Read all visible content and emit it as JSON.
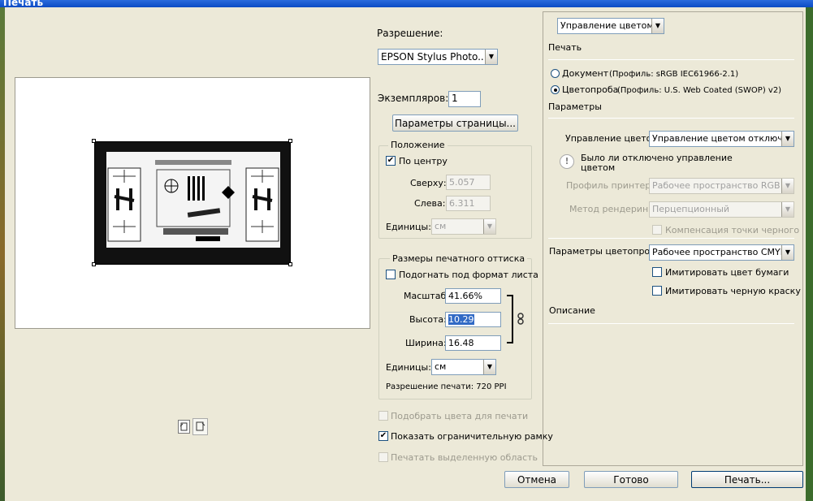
{
  "window": {
    "title": "Печать"
  },
  "left": {
    "resolution_label": "Разрешение:",
    "printer_value": "EPSON Stylus Photo...",
    "copies_label": "Экземпляров:",
    "copies_value": "1",
    "page_setup_button": "Параметры страницы...",
    "position": {
      "title": "Положение",
      "center_label": "По центру",
      "center_checked": true,
      "top_label": "Сверху:",
      "top_value": "5.057",
      "left_label": "Слева:",
      "left_value": "6.311",
      "units_label": "Единицы:",
      "units_value": "см"
    },
    "print_size": {
      "title": "Размеры печатного оттиска",
      "fit_label": "Подогнать под формат листа",
      "fit_checked": false,
      "scale_label": "Масштаб:",
      "scale_value": "41.66%",
      "height_label": "Высота:",
      "height_value": "10.29",
      "width_label": "Ширина:",
      "width_value": "16.48",
      "units_label": "Единицы:",
      "units_value": "см",
      "print_resolution": "Разрешение печати: 720 PPI"
    },
    "match_colors": "Подобрать цвета для печати",
    "show_bounding_box": "Показать ограничительную рамку",
    "print_selected_area": "Печатать выделенную область"
  },
  "right": {
    "mode_select": "Управление цветом",
    "print_header": "Печать",
    "document_label": "Документ",
    "document_profile": "(Профиль: sRGB IEC61966-2.1)",
    "proof_label": "Цветопроба",
    "proof_profile": "(Профиль: U.S. Web Coated (SWOP) v2)",
    "params_header": "Параметры",
    "color_handling_label": "Управление цветом:",
    "color_handling_value": "Управление цветом отключено",
    "notice": "Было ли отключено управление",
    "notice_2": "цветом",
    "printer_profile_label": "Профиль принтера:",
    "printer_profile_value": "Рабочее пространство RGB - A...",
    "render_method_label": "Метод рендеринга:",
    "render_method_value": "Перцепционный",
    "black_point": "Компенсация точки черного",
    "proof_setup_label": "Параметры цветопробы:",
    "proof_setup_value": "Рабочее пространство CMYK",
    "simulate_paper": "Имитировать цвет бумаги",
    "simulate_black": "Имитировать черную краску",
    "description_header": "Описание"
  },
  "buttons": {
    "cancel": "Отмена",
    "done": "Готово",
    "print": "Печать..."
  },
  "colors": {
    "title_bar": "#0b4bc4",
    "dialog_bg": "#ece9d8",
    "field_border": "#7f9db9"
  }
}
